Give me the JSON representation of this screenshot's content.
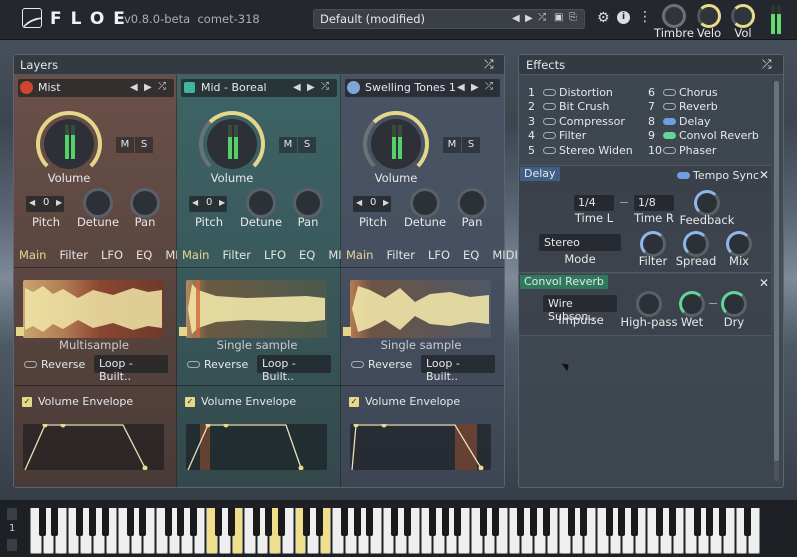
{
  "app": {
    "name": "FLOE",
    "version": "v0.8.0-beta",
    "build": "comet-318"
  },
  "preset": {
    "name": "Default (modified)"
  },
  "top_knobs": [
    {
      "label": "Timbre"
    },
    {
      "label": "Velo"
    },
    {
      "label": "Vol"
    }
  ],
  "layers_panel": {
    "title": "Layers"
  },
  "layers": [
    {
      "name": "Mist",
      "volume_label": "Volume",
      "mute": "M",
      "solo": "S",
      "pitch_value": "0",
      "pitch_label": "Pitch",
      "detune_label": "Detune",
      "pan_label": "Pan",
      "tabs": [
        "Main",
        "Filter",
        "LFO",
        "EQ",
        "MIDI"
      ],
      "sample_mode": "Multisample",
      "reverse_label": "Reverse",
      "loop": "Loop - Built..",
      "envelope_label": "Volume Envelope"
    },
    {
      "name": "Mid - Boreal",
      "volume_label": "Volume",
      "mute": "M",
      "solo": "S",
      "pitch_value": "0",
      "pitch_label": "Pitch",
      "detune_label": "Detune",
      "pan_label": "Pan",
      "tabs": [
        "Main",
        "Filter",
        "LFO",
        "EQ",
        "MIDI"
      ],
      "sample_mode": "Single sample",
      "reverse_label": "Reverse",
      "loop": "Loop - Built..",
      "envelope_label": "Volume Envelope"
    },
    {
      "name": "Swelling Tones 1",
      "volume_label": "Volume",
      "mute": "M",
      "solo": "S",
      "pitch_value": "0",
      "pitch_label": "Pitch",
      "detune_label": "Detune",
      "pan_label": "Pan",
      "tabs": [
        "Main",
        "Filter",
        "LFO",
        "EQ",
        "MIDI"
      ],
      "sample_mode": "Single sample",
      "reverse_label": "Reverse",
      "loop": "Loop - Built..",
      "envelope_label": "Volume Envelope"
    }
  ],
  "effects_panel": {
    "title": "Effects"
  },
  "effects": [
    {
      "num": "1",
      "name": "Distortion",
      "on": false
    },
    {
      "num": "2",
      "name": "Bit Crush",
      "on": false
    },
    {
      "num": "3",
      "name": "Compressor",
      "on": false
    },
    {
      "num": "4",
      "name": "Filter",
      "on": false
    },
    {
      "num": "5",
      "name": "Stereo Widen",
      "on": false
    },
    {
      "num": "6",
      "name": "Chorus",
      "on": false
    },
    {
      "num": "7",
      "name": "Reverb",
      "on": false
    },
    {
      "num": "8",
      "name": "Delay",
      "on": true
    },
    {
      "num": "9",
      "name": "Convol Reverb",
      "on": true
    },
    {
      "num": "10",
      "name": "Phaser",
      "on": false
    }
  ],
  "delay": {
    "title": "Delay",
    "tempo_sync": "Tempo Sync",
    "time_l_value": "1/4",
    "time_l_label": "Time L",
    "time_r_value": "1/8",
    "time_r_label": "Time R",
    "feedback_label": "Feedback",
    "mode_value": "Stereo",
    "mode_label": "Mode",
    "filter_label": "Filter",
    "spread_label": "Spread",
    "mix_label": "Mix"
  },
  "convol": {
    "title": "Convol Reverb",
    "impulse_value": "Wire Subson..",
    "impulse_label": "Impulse",
    "highpass_label": "High-pass",
    "wet_label": "Wet",
    "dry_label": "Dry"
  },
  "keyboard": {
    "octave": "1"
  }
}
